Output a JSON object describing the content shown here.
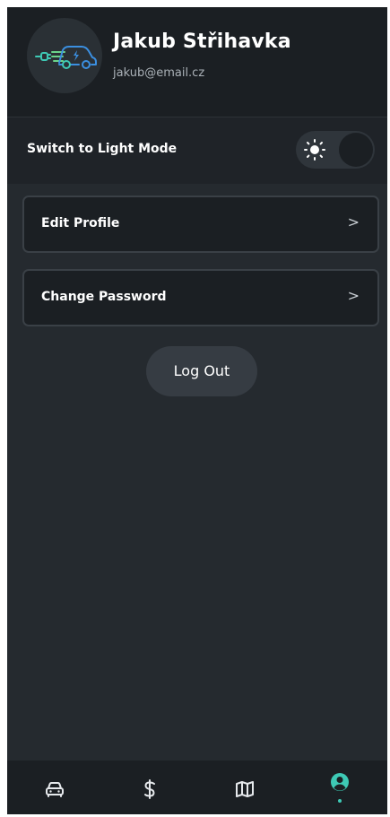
{
  "profile": {
    "name": "Jakub Střihavka",
    "email": "jakub@email.cz",
    "avatar_icon": "ev-charging-car-icon"
  },
  "theme": {
    "label": "Switch to Light Mode",
    "toggle_icon": "sun-icon",
    "is_dark_mode": true
  },
  "menu": {
    "items": [
      {
        "label": "Edit Profile",
        "chevron": ">"
      },
      {
        "label": "Change Password",
        "chevron": ">"
      }
    ],
    "logout_label": "Log Out"
  },
  "bottom_nav": {
    "items": [
      {
        "icon": "car-icon"
      },
      {
        "icon": "dollar-icon"
      },
      {
        "icon": "map-icon"
      },
      {
        "icon": "user-icon",
        "active": true
      }
    ]
  },
  "colors": {
    "background": "#252a2f",
    "surface": "#1b1f23",
    "accent": "#3ec9b5",
    "card_border": "#3a4046",
    "text": "#ffffff"
  }
}
